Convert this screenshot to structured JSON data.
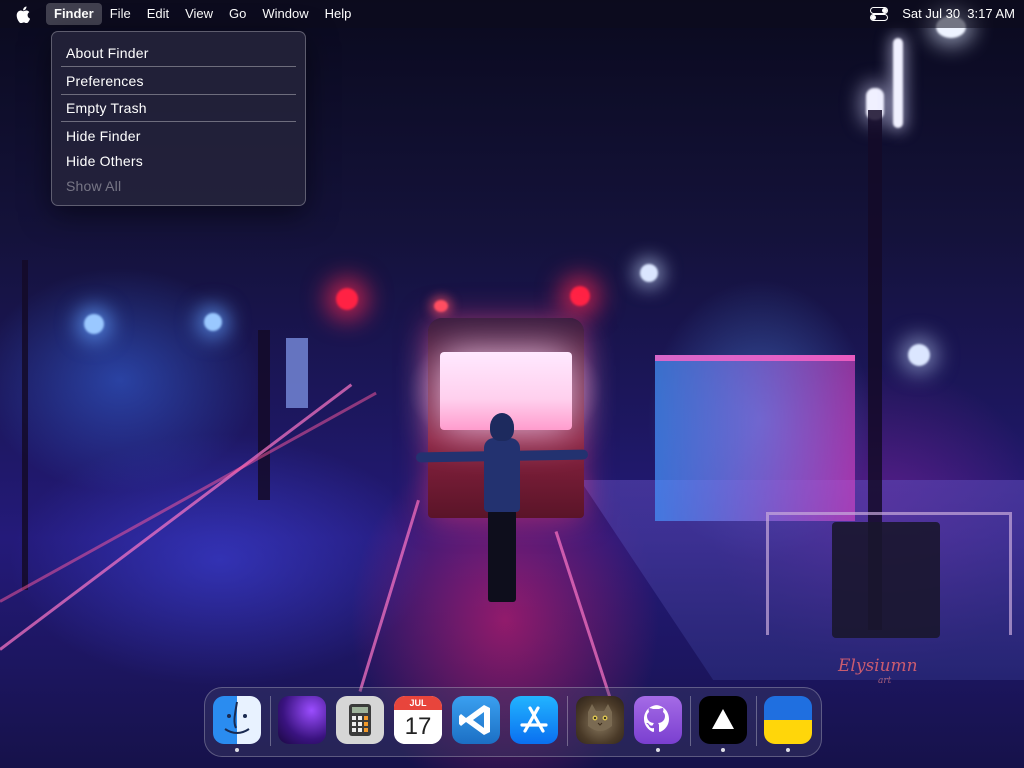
{
  "menubar": {
    "apple_icon": "apple-logo-icon",
    "items": [
      "Finder",
      "File",
      "Edit",
      "View",
      "Go",
      "Window",
      "Help"
    ],
    "active_item": "Finder",
    "control_center_icon": "control-center-icon",
    "datetime": "Sat Jul 30  3:17 AM"
  },
  "finder_menu": {
    "items": [
      {
        "label": "About Finder",
        "enabled": true
      },
      {
        "label": "Preferences",
        "enabled": true
      },
      {
        "label": "Empty Trash",
        "enabled": true
      },
      {
        "label": "Hide Finder",
        "enabled": true
      },
      {
        "label": "Hide Others",
        "enabled": true
      },
      {
        "label": "Show All",
        "enabled": false
      }
    ]
  },
  "dock": {
    "apps": [
      {
        "icon": "finder-icon",
        "running": true
      },
      {
        "icon": "purple-wallpaper-app-icon",
        "running": false
      },
      {
        "icon": "calculator-icon",
        "running": false
      },
      {
        "icon": "calendar-icon",
        "running": false,
        "month": "JUL",
        "day": "17"
      },
      {
        "icon": "vscode-icon",
        "running": false
      },
      {
        "icon": "app-store-icon",
        "running": false
      },
      {
        "icon": "cat-photo-app-icon",
        "running": false
      },
      {
        "icon": "github-icon",
        "running": true
      },
      {
        "icon": "triangle-app-icon",
        "running": true
      },
      {
        "icon": "ukraine-flag-icon",
        "running": true
      }
    ]
  },
  "wallpaper": {
    "watermark": "Elysiumn",
    "watermark_sub": "art"
  },
  "colors": {
    "menubar_bg": "#0f0c1e",
    "accent_pink": "#ff2a8a",
    "accent_blue": "#3c6cff"
  }
}
